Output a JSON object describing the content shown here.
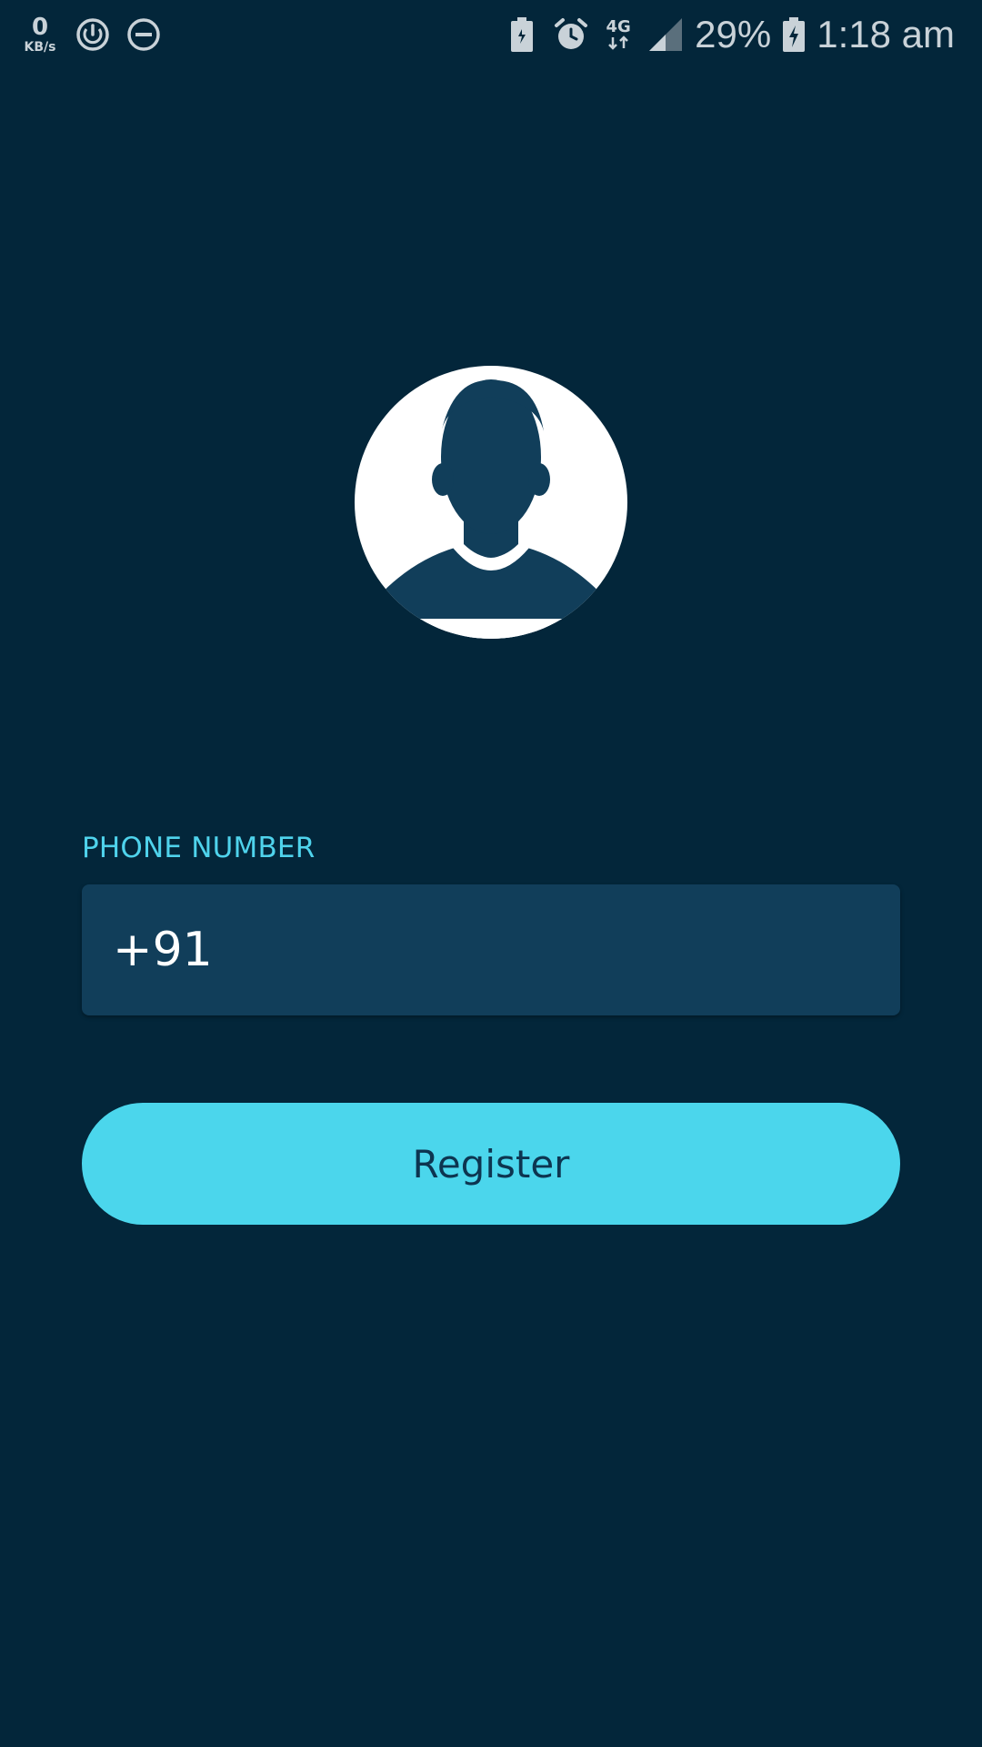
{
  "status_bar": {
    "net_speed_value": "0",
    "net_speed_unit": "KB/s",
    "left_icons": [
      "power-sync-icon",
      "do-not-disturb-icon"
    ],
    "right_icons": [
      "battery-saver-icon",
      "alarm-icon",
      "network-4g-icon",
      "signal-icon",
      "charging-battery-icon"
    ],
    "network_label": "4G",
    "battery_percent": "29%",
    "time": "1:18 am"
  },
  "avatar": {
    "icon": "user-avatar-icon"
  },
  "form": {
    "phone_label": "PHONE NUMBER",
    "phone_value": "+91"
  },
  "actions": {
    "register_label": "Register"
  },
  "colors": {
    "background": "#03263a",
    "field_bg": "#113e5a",
    "accent": "#4bd6ec",
    "label": "#4fd3ec",
    "button_text": "#0d3550",
    "status_text": "#c9d2d8"
  }
}
